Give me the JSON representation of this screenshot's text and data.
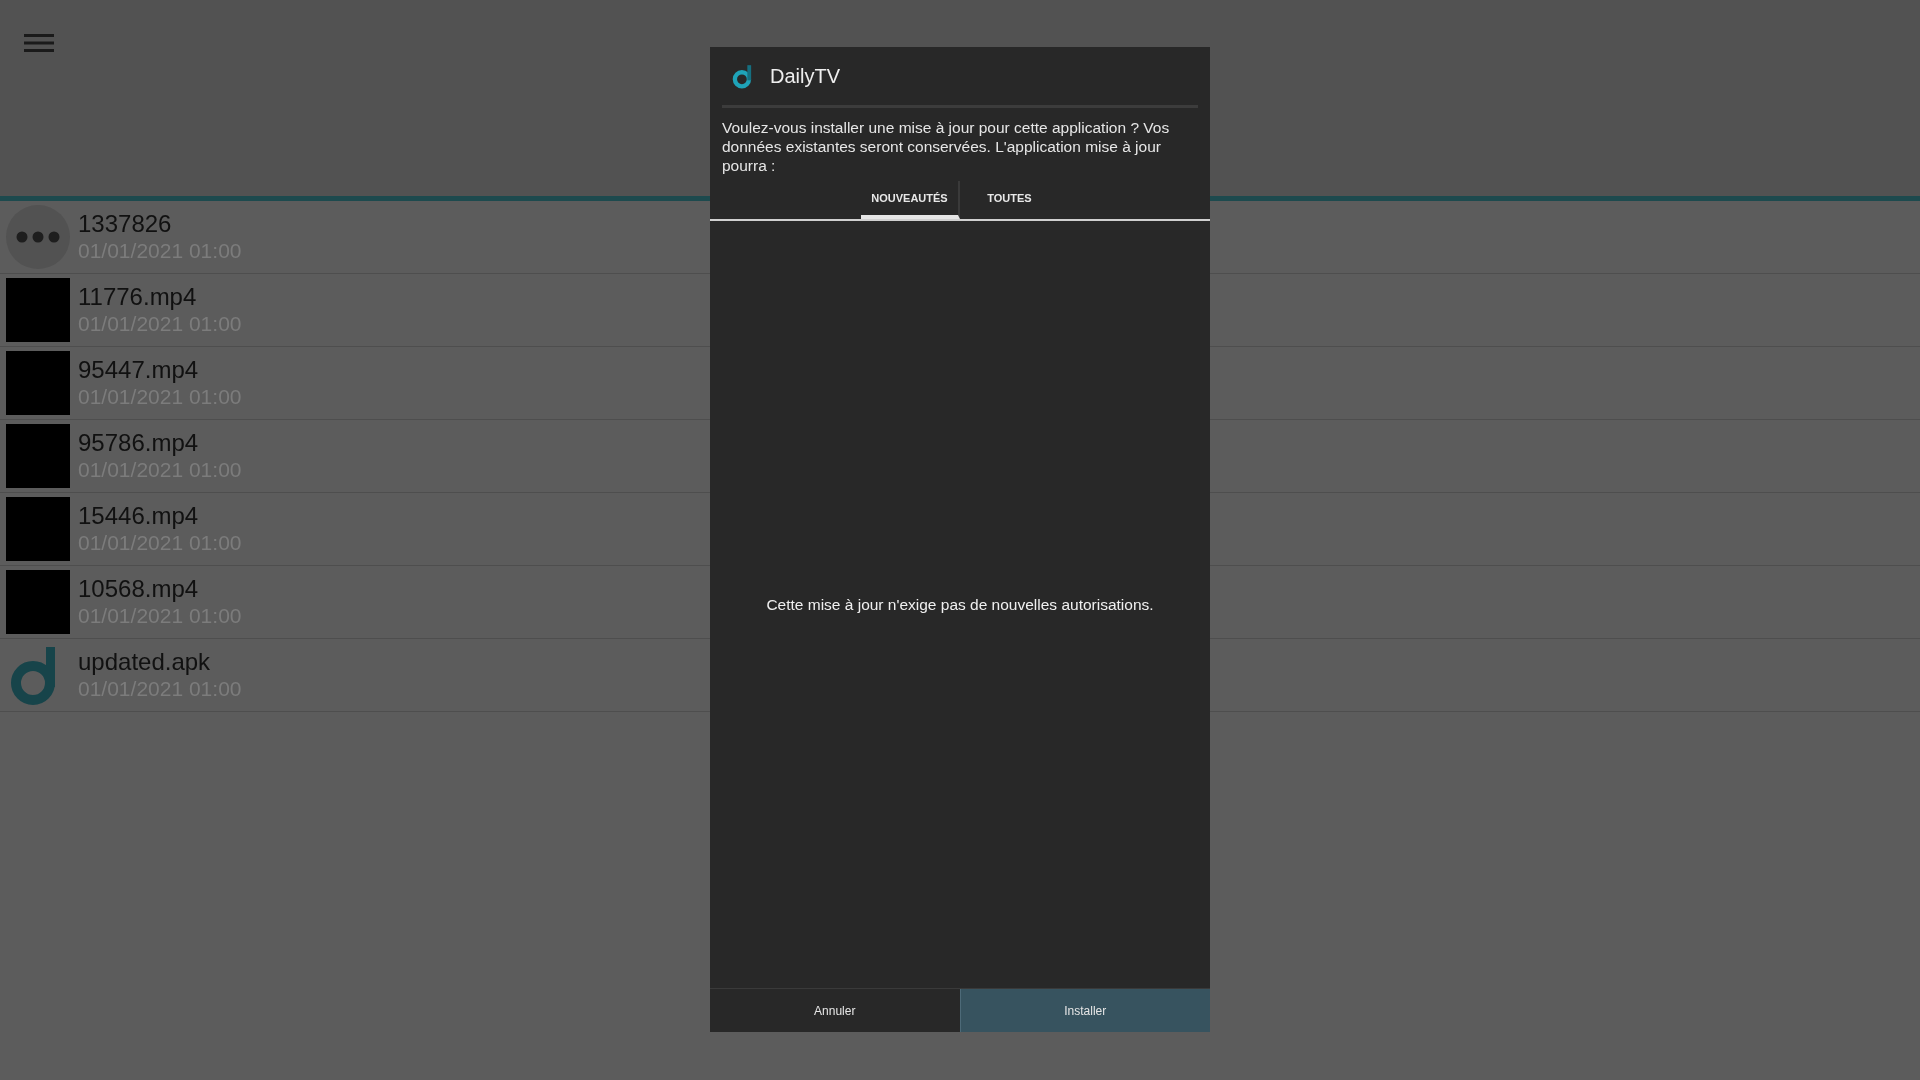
{
  "files": [
    {
      "kind": "folder",
      "name": "1337826",
      "date": "01/01/2021 01:00"
    },
    {
      "kind": "video",
      "name": "11776.mp4",
      "date": "01/01/2021 01:00"
    },
    {
      "kind": "video",
      "name": "95447.mp4",
      "date": "01/01/2021 01:00"
    },
    {
      "kind": "video",
      "name": "95786.mp4",
      "date": "01/01/2021 01:00"
    },
    {
      "kind": "video",
      "name": "15446.mp4",
      "date": "01/01/2021 01:00"
    },
    {
      "kind": "video",
      "name": "10568.mp4",
      "date": "01/01/2021 01:00"
    },
    {
      "kind": "apk",
      "name": "updated.apk",
      "date": "01/01/2021 01:00"
    }
  ],
  "dialog": {
    "title": "DailyTV",
    "message": "Voulez-vous installer une mise à jour pour cette application ? Vos données existantes seront conservées. L'application mise à jour pourra :",
    "tabs": [
      {
        "label": "NOUVEAUTÉS",
        "selected": true
      },
      {
        "label": "TOUTES",
        "selected": false
      }
    ],
    "body": "Cette mise à jour n'exige pas de nouvelles autorisations.",
    "buttons": [
      {
        "label": "Annuler",
        "kind": "cancel"
      },
      {
        "label": "Installer",
        "kind": "primary"
      }
    ]
  }
}
